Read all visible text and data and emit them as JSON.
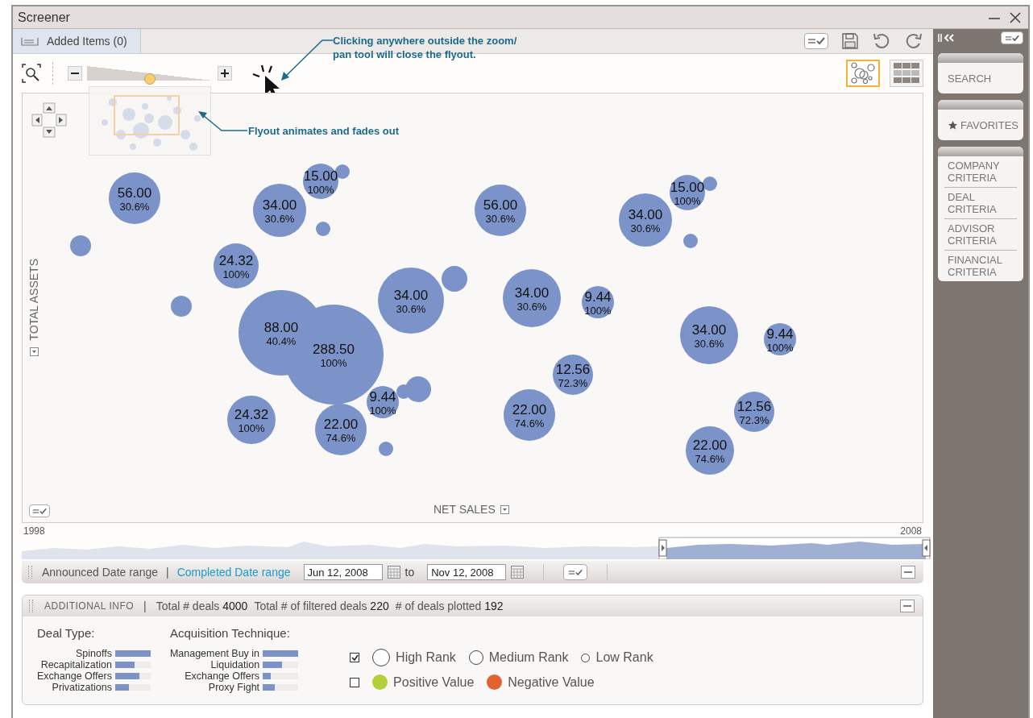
{
  "window": {
    "title": "Screener"
  },
  "toolbar": {
    "tab": {
      "label": "Added Items (0)",
      "selected": true
    },
    "zoom": {
      "level": 0.5
    },
    "views": [
      {
        "kind": "bubble",
        "selected": true
      },
      {
        "kind": "grid",
        "selected": false
      }
    ]
  },
  "annotations": [
    "Clicking anywhere outside the zoom/\npan tool will close the flyout.",
    "Flyout animates and fades out"
  ],
  "chart": {
    "y_axis": "TOTAL ASSETS",
    "x_axis": "NET SALES",
    "bubbles": [
      {
        "value": "56.00",
        "share": "30.6%"
      },
      {
        "value": "15.00",
        "share": "100%"
      },
      {
        "value": "34.00",
        "share": "30.6%"
      },
      {
        "value": "56.00",
        "share": "30.6%"
      },
      {
        "value": "15.00",
        "share": "100%"
      },
      {
        "value": "34.00",
        "share": "30.6%"
      },
      {
        "value": "24.32",
        "share": "100%"
      },
      {
        "value": "34.00",
        "share": "30.6%"
      },
      {
        "value": "34.00",
        "share": "30.6%"
      },
      {
        "value": "9.44",
        "share": "100%"
      },
      {
        "value": "88.00",
        "share": "40.4%"
      },
      {
        "value": "288.50",
        "share": "100%"
      },
      {
        "value": "34.00",
        "share": "30.6%"
      },
      {
        "value": "9.44",
        "share": "100%"
      },
      {
        "value": "12.56",
        "share": "72.3%"
      },
      {
        "value": "9.44",
        "share": "100%"
      },
      {
        "value": "24.32",
        "share": "100%"
      },
      {
        "value": "22.00",
        "share": "74.6%"
      },
      {
        "value": "22.00",
        "share": "74.6%"
      },
      {
        "value": "12.56",
        "share": "72.3%"
      },
      {
        "value": "22.00",
        "share": "74.6%"
      }
    ]
  },
  "timeline": {
    "start": "1998",
    "end": "2008"
  },
  "date_range": {
    "tabs": [
      {
        "label": "Announced Date range",
        "selected": false
      },
      {
        "label": "Completed Date range",
        "selected": true
      }
    ],
    "separator": "|",
    "from": "Jun 12, 2008",
    "to_label": "to",
    "to": "Nov 12, 2008"
  },
  "additional_info": {
    "title": "ADDITIONAL INFO",
    "separator": "|",
    "stats": [
      {
        "label": "Total # deals",
        "value": "4000"
      },
      {
        "label": "Total # of filtered deals",
        "value": "220"
      },
      {
        "label": "# of deals plotted",
        "value": "192"
      }
    ],
    "groups": [
      {
        "title": "Deal Type:",
        "items": [
          {
            "label": "Spinoffs",
            "level": 1
          },
          {
            "label": "Recapitalization",
            "level": 0.55
          },
          {
            "label": "Exchange Offers",
            "level": 0.68
          },
          {
            "label": "Privatizations",
            "level": 0.4
          }
        ]
      },
      {
        "title": "Acquisition Technique:",
        "items": [
          {
            "label": "Management Buy in",
            "level": 1
          },
          {
            "label": "Liquidation",
            "level": 0.55
          },
          {
            "label": "Exchange Offers",
            "level": 0.22
          },
          {
            "label": "Proxy Fight",
            "level": 0.35
          }
        ]
      }
    ],
    "legend": [
      {
        "checked": true,
        "items": [
          {
            "kind": "size",
            "label": "High Rank"
          },
          {
            "kind": "size",
            "label": "Medium Rank"
          },
          {
            "kind": "size",
            "label": "Low Rank"
          }
        ]
      },
      {
        "checked": false,
        "items": [
          {
            "kind": "color",
            "label": "Positive Value",
            "color": "#b5cf3a"
          },
          {
            "kind": "color",
            "label": "Negative Value",
            "color": "#e2632f"
          }
        ]
      }
    ]
  },
  "sidebar": {
    "sections": [
      {
        "kind": "search",
        "items": [
          {
            "label": "SEARCH"
          }
        ]
      },
      {
        "kind": "favorites",
        "items": [
          {
            "label": "FAVORITES"
          }
        ]
      },
      {
        "kind": "criteria",
        "items": [
          {
            "label": "COMPANY\nCRITERIA"
          },
          {
            "label": "DEAL\nCRITERIA"
          },
          {
            "label": "ADVISOR\nCRITERIA"
          },
          {
            "label": "FINANCIAL\nCRITERIA"
          }
        ]
      }
    ]
  }
}
